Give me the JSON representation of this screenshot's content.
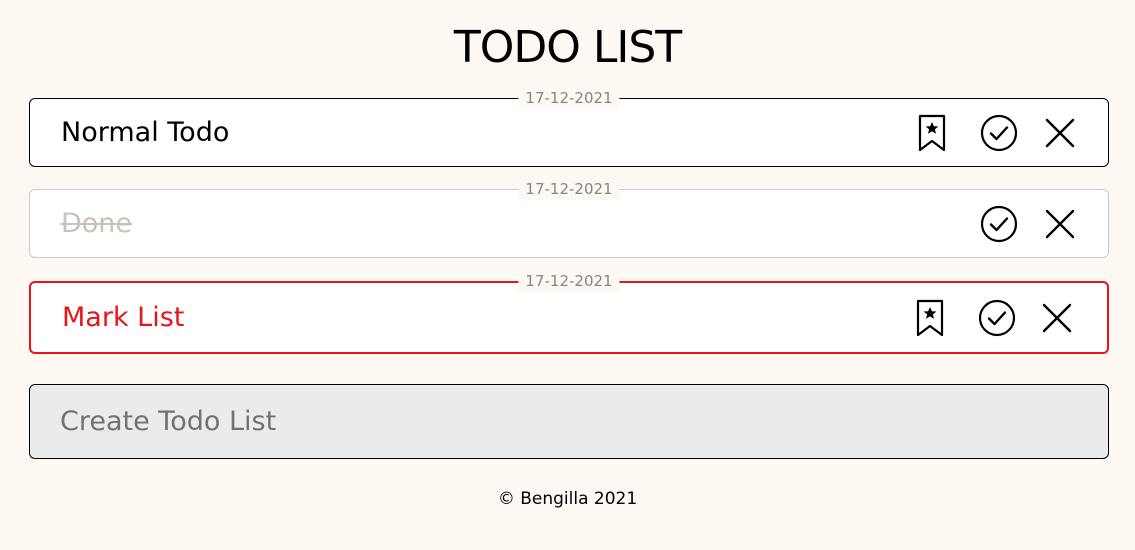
{
  "app": {
    "title": "TODO LIST"
  },
  "todos": [
    {
      "date": "17-12-2021",
      "text": "Normal Todo",
      "state": "normal",
      "actions": [
        "bookmark-icon",
        "check-circle-icon",
        "close-icon"
      ]
    },
    {
      "date": "17-12-2021",
      "text": "Done",
      "state": "done",
      "actions": [
        "check-circle-icon",
        "close-icon"
      ]
    },
    {
      "date": "17-12-2021",
      "text": "Mark List",
      "state": "marked",
      "actions": [
        "bookmark-icon",
        "check-circle-icon",
        "close-icon"
      ]
    }
  ],
  "create": {
    "placeholder": "Create Todo List",
    "value": ""
  },
  "footer": {
    "text": "© Bengilla 2021"
  },
  "colors": {
    "background": "#fdf8f2",
    "marked": "#e8141b",
    "done_text": "#c7c2bb",
    "input_bg": "#ebebeb"
  }
}
